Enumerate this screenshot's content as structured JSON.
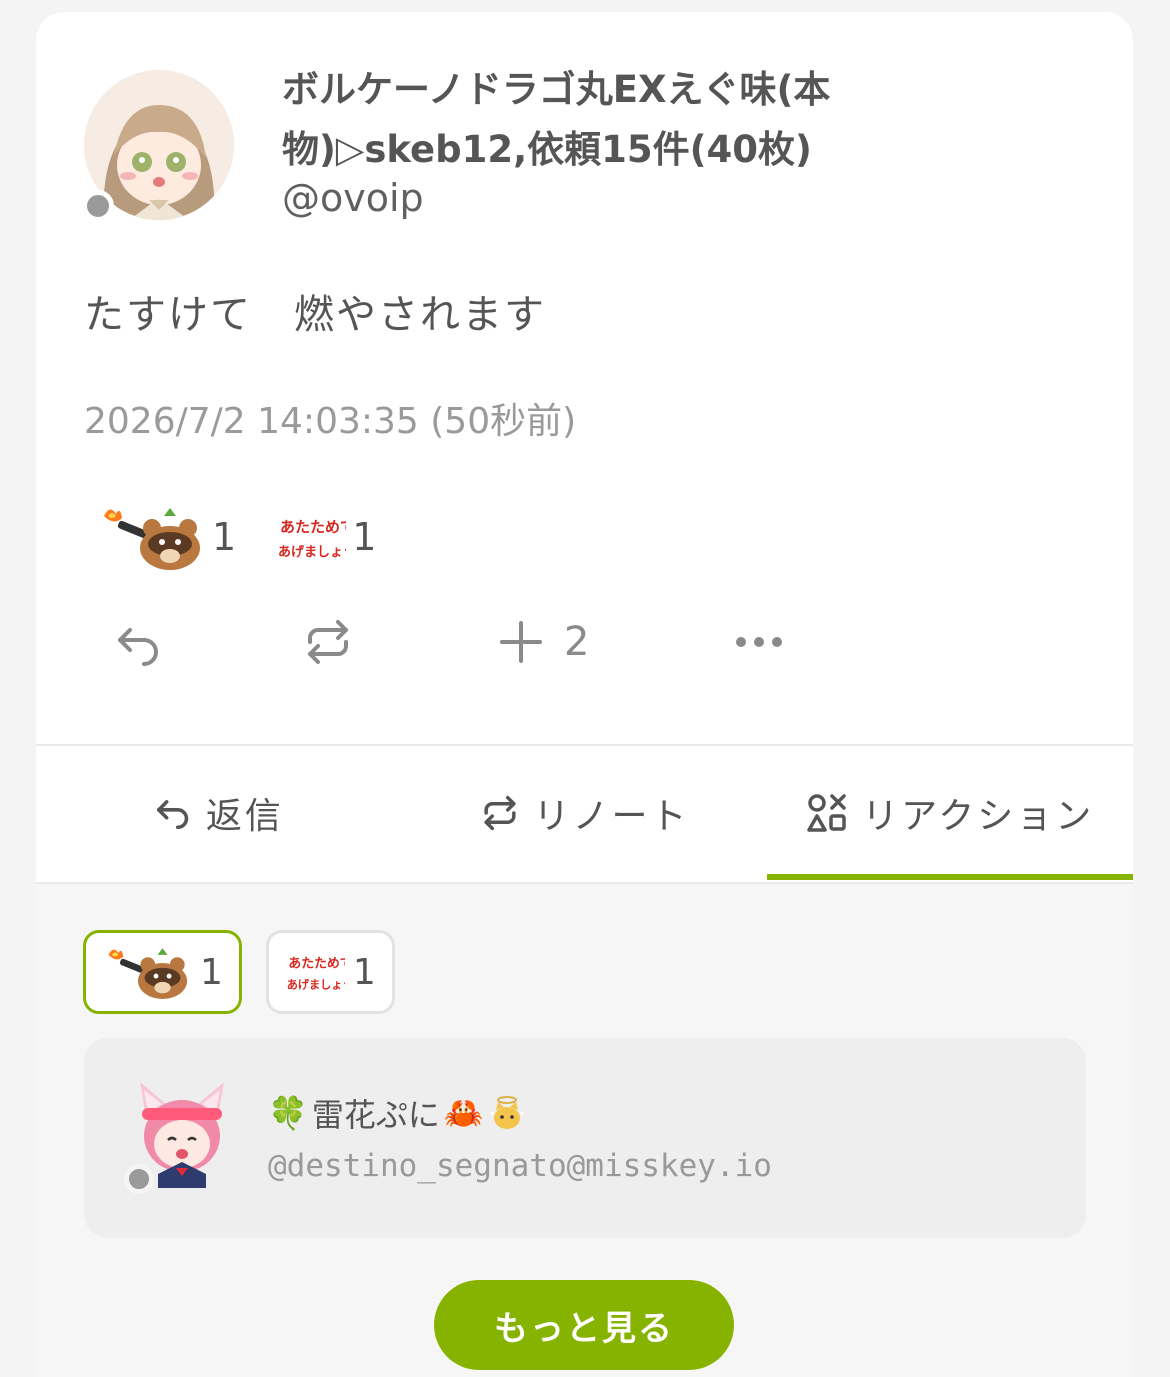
{
  "note": {
    "user": {
      "name": "ボルケーノドラゴ丸EXえぐ味(本物)▷skeb12,依頼15件(40枚)",
      "handle": "@ovoip"
    },
    "text": "たすけて　燃やされます",
    "time": "2026/7/2 14:03:35 (50秒前)",
    "reactions": [
      {
        "icon": "raccoon-flamethrower-emoji",
        "count": "1"
      },
      {
        "icon": "atatamete-agemashou-ne-emoji",
        "count": "1"
      }
    ],
    "actions": {
      "reply_icon": "reply-icon",
      "renote_icon": "renote-icon",
      "react_icon": "plus-icon",
      "react_count": "2",
      "more_icon": "more-icon"
    }
  },
  "tabs": [
    {
      "label": "返信",
      "icon": "reply-icon"
    },
    {
      "label": "リノート",
      "icon": "renote-icon"
    },
    {
      "label": "リアクション",
      "icon": "shapes-icon",
      "active": true
    }
  ],
  "reaction_filter": [
    {
      "icon": "raccoon-flamethrower-emoji",
      "count": "1",
      "active": true
    },
    {
      "icon": "atatamete-agemashou-ne-emoji",
      "count": "1"
    }
  ],
  "reactors": [
    {
      "name": "雷花ぷに",
      "emoji_before": "🍀",
      "emoji_after": "🦀",
      "handle": "@destino_segnato@misskey.io"
    }
  ],
  "more_button": "もっと見る",
  "colors": {
    "accent": "#86b300",
    "background": "#f4f4f4"
  }
}
